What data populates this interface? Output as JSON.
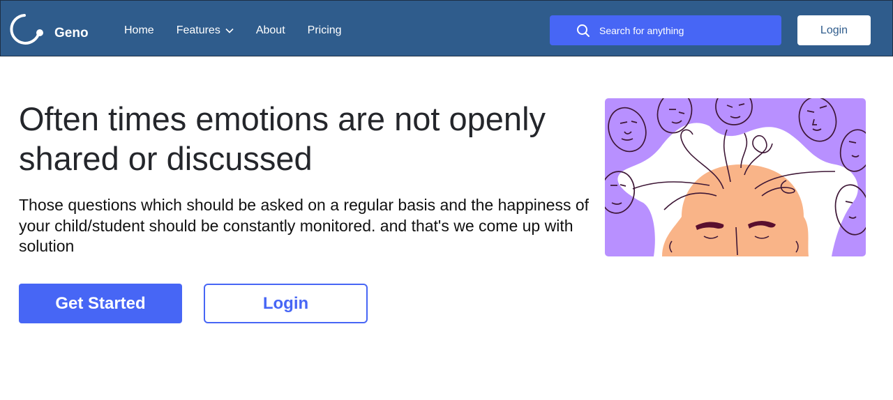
{
  "brand": {
    "name": "Geno",
    "logo_icon": "ring-dot-icon"
  },
  "nav": {
    "items": [
      {
        "label": "Home"
      },
      {
        "label": "Features",
        "icon": "chevron-down-icon"
      },
      {
        "label": "About"
      },
      {
        "label": "Pricing"
      }
    ],
    "search_placeholder": "Search for anything",
    "login_label": "Login"
  },
  "hero": {
    "title": "Often times emotions are not openly shared or discussed",
    "subtitle": "Those questions which should be asked on a regular basis and the happiness of your child/student should be constantly monitored. and that's we come up with solution",
    "primary_button": "Get Started",
    "secondary_button": "Login"
  },
  "colors": {
    "navbar": "#2f5c8c",
    "accent": "#4766f5",
    "illustration_purple": "#b890ff",
    "skin": "#f9b488"
  }
}
